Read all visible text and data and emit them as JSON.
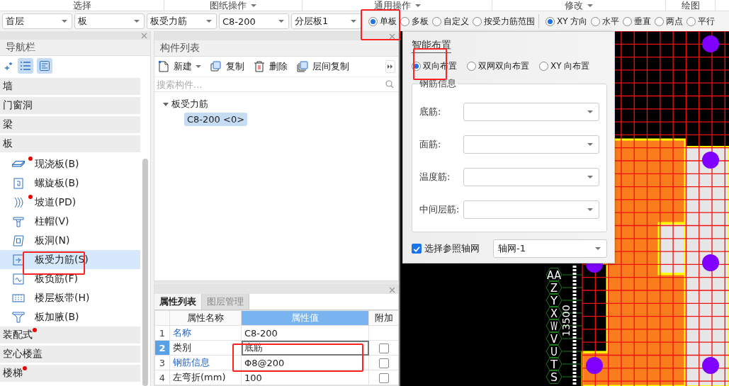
{
  "ribbon_groups": [
    {
      "label": "选择",
      "menu": false
    },
    {
      "label": "图纸操作",
      "menu": true
    },
    {
      "label": "通用操作",
      "menu": true
    },
    {
      "label": "修改",
      "menu": true
    },
    {
      "label": "绘图",
      "menu": false
    }
  ],
  "toolbar": {
    "selectors": [
      "首层",
      "板",
      "板受力筋",
      "C8-200",
      "分层板1"
    ],
    "scope_options": [
      {
        "label": "单板",
        "selected": true
      },
      {
        "label": "多板",
        "selected": false
      },
      {
        "label": "自定义",
        "selected": false
      },
      {
        "label": "按受力筋范围",
        "selected": false
      }
    ],
    "direction_options": [
      {
        "label": "XY 方向",
        "selected": true
      },
      {
        "label": "水平",
        "selected": false
      },
      {
        "label": "垂直",
        "selected": false
      },
      {
        "label": "两点",
        "selected": false
      },
      {
        "label": "平行",
        "selected": false
      }
    ]
  },
  "navigation": {
    "title": "导航栏",
    "categories": [
      {
        "label": "墙",
        "flagged": false
      },
      {
        "label": "门窗洞",
        "flagged": false
      },
      {
        "label": "梁",
        "flagged": false
      },
      {
        "label": "板",
        "flagged": false,
        "children": [
          {
            "label": "现浇板(B)",
            "flagged": true,
            "selected": false
          },
          {
            "label": "螺旋板(B)",
            "flagged": false,
            "selected": false
          },
          {
            "label": "坡道(PD)",
            "flagged": true,
            "selected": false
          },
          {
            "label": "柱帽(V)",
            "flagged": false,
            "selected": false
          },
          {
            "label": "板洞(N)",
            "flagged": false,
            "selected": false
          },
          {
            "label": "板受力筋(S)",
            "flagged": false,
            "selected": true
          },
          {
            "label": "板负筋(F)",
            "flagged": false,
            "selected": false
          },
          {
            "label": "楼层板带(H)",
            "flagged": false,
            "selected": false
          },
          {
            "label": "板加腋(B)",
            "flagged": false,
            "selected": false
          }
        ]
      },
      {
        "label": "装配式",
        "flagged": true
      },
      {
        "label": "空心楼盖",
        "flagged": false
      },
      {
        "label": "楼梯",
        "flagged": true
      }
    ]
  },
  "components": {
    "title": "构件列表",
    "actions": [
      {
        "label": "新建",
        "menu": true
      },
      {
        "label": "复制",
        "menu": false
      },
      {
        "label": "删除",
        "menu": false
      },
      {
        "label": "层间复制",
        "menu": false
      }
    ],
    "search_placeholder": "搜索构件...",
    "tree": [
      {
        "label": "板受力筋",
        "expanded": true,
        "children": [
          {
            "label": "C8-200 <0>",
            "selected": true
          }
        ]
      }
    ]
  },
  "properties": {
    "tabs": [
      {
        "label": "属性列表",
        "selected": true
      },
      {
        "label": "图层管理",
        "selected": false
      }
    ],
    "columns": [
      "属性名称",
      "属性值",
      "附加"
    ],
    "rows": [
      {
        "index": "1",
        "name": "名称",
        "linked": true,
        "value": "C8-200",
        "selected": false
      },
      {
        "index": "2",
        "name": "类别",
        "linked": false,
        "value": "底筋",
        "selected": true,
        "extra": false
      },
      {
        "index": "3",
        "name": "钢筋信息",
        "linked": true,
        "value": "Φ8@200",
        "selected": false,
        "extra": false
      },
      {
        "index": "4",
        "name": "左弯折(mm)",
        "linked": false,
        "value": "100",
        "selected": false,
        "extra": false
      }
    ]
  },
  "dialog": {
    "title": "智能布置",
    "modes": [
      {
        "label": "双向布置",
        "selected": true
      },
      {
        "label": "双网双向布置",
        "selected": false
      },
      {
        "label": "XY 向布置",
        "selected": false
      }
    ],
    "group_title": "钢筋信息",
    "fields": [
      {
        "label": "底筋:"
      },
      {
        "label": "面筋:"
      },
      {
        "label": "温度筋:"
      },
      {
        "label": "中间层筋:"
      }
    ],
    "reference": {
      "label": "选择参照轴网",
      "checked": true,
      "value": "轴网-1"
    }
  },
  "canvas": {
    "axis_labels": [
      "AA",
      "Z",
      "Y",
      "X",
      "W",
      "V",
      "U",
      "T",
      "S"
    ],
    "dimension": "13500"
  }
}
